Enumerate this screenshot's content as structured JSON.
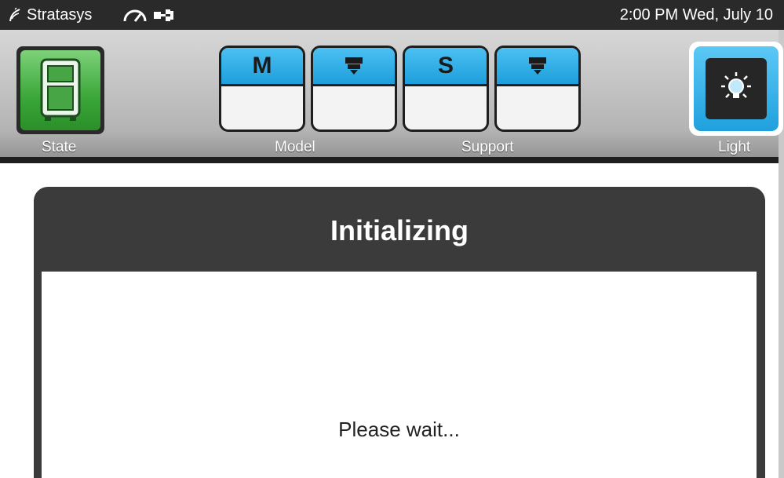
{
  "status_bar": {
    "brand": "Stratasys",
    "clock": "2:00 PM Wed, July 10"
  },
  "toolbar": {
    "state_label": "State",
    "model_label": "Model",
    "support_label": "Support",
    "light_label": "Light",
    "cartridges": [
      {
        "letter": "M",
        "icon": "model-material-cartridge"
      },
      {
        "letter": "",
        "icon": "model-head-icon"
      },
      {
        "letter": "S",
        "icon": "support-material-cartridge"
      },
      {
        "letter": "",
        "icon": "support-head-icon"
      }
    ]
  },
  "dialog": {
    "title": "Initializing",
    "message": "Please wait..."
  },
  "colors": {
    "status_bar_bg": "#2a2a2a",
    "state_green": "#3aa638",
    "cartridge_blue": "#1d9fdc",
    "light_blue": "#1fa0de",
    "dialog_header": "#3b3b3c"
  }
}
